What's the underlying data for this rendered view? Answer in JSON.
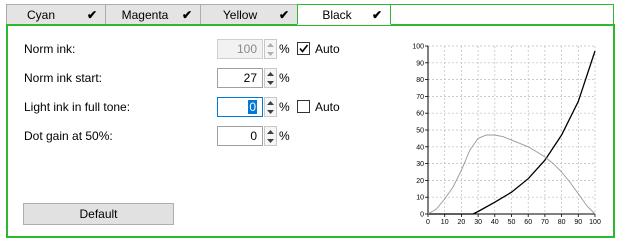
{
  "tabs": [
    {
      "label": "Cyan",
      "check": "✔",
      "active": false
    },
    {
      "label": "Magenta",
      "check": "✔",
      "active": false
    },
    {
      "label": "Yellow",
      "check": "✔",
      "active": false
    },
    {
      "label": "Black",
      "check": "✔",
      "active": true
    }
  ],
  "fields": {
    "norm_ink": {
      "label": "Norm ink:",
      "value": "100",
      "unit": "%",
      "auto_label": "Auto",
      "auto_checked": true,
      "disabled": true
    },
    "norm_ink_start": {
      "label": "Norm ink start:",
      "value": "27",
      "unit": "%"
    },
    "light_ink": {
      "label": "Light ink in full tone:",
      "value": "0",
      "unit": "%",
      "auto_label": "Auto",
      "auto_checked": false
    },
    "dot_gain": {
      "label": "Dot gain at 50%:",
      "value": "0",
      "unit": "%"
    }
  },
  "default_button": "Default",
  "colors": {
    "accent": "#2eb82e",
    "focus": "#0078d7"
  },
  "chart_data": {
    "type": "line",
    "xlim": [
      0,
      100
    ],
    "ylim": [
      0,
      100
    ],
    "x_ticks": [
      "0",
      "10",
      "20",
      "30",
      "40",
      "50",
      "60",
      "70",
      "80",
      "90",
      "100"
    ],
    "y_ticks": [
      "0",
      "10",
      "20",
      "30",
      "40",
      "50",
      "60",
      "70",
      "80",
      "90",
      "100"
    ],
    "grid": true,
    "series": [
      {
        "color": "#000000",
        "points": [
          [
            0,
            0
          ],
          [
            10,
            0
          ],
          [
            20,
            0
          ],
          [
            27,
            0
          ],
          [
            30,
            1.5
          ],
          [
            40,
            7
          ],
          [
            50,
            13
          ],
          [
            60,
            21
          ],
          [
            70,
            32
          ],
          [
            80,
            47
          ],
          [
            90,
            67
          ],
          [
            100,
            97
          ]
        ]
      },
      {
        "color": "#999999",
        "points": [
          [
            0,
            0
          ],
          [
            5,
            3
          ],
          [
            10,
            9
          ],
          [
            15,
            16
          ],
          [
            20,
            26
          ],
          [
            25,
            38
          ],
          [
            30,
            45
          ],
          [
            35,
            47
          ],
          [
            40,
            47
          ],
          [
            45,
            46
          ],
          [
            50,
            44
          ],
          [
            55,
            42
          ],
          [
            60,
            40
          ],
          [
            65,
            37
          ],
          [
            70,
            34
          ],
          [
            75,
            30
          ],
          [
            80,
            25
          ],
          [
            85,
            19
          ],
          [
            90,
            12
          ],
          [
            95,
            5
          ],
          [
            100,
            0
          ]
        ]
      }
    ]
  }
}
